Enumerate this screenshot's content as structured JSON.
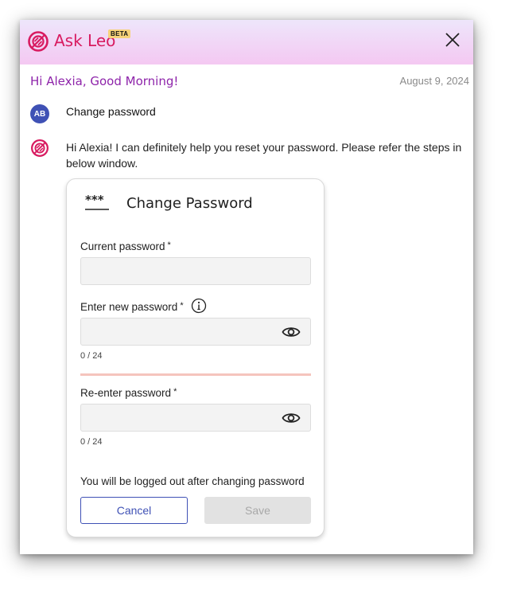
{
  "header": {
    "app_title": "Ask Leo",
    "badge": "BETA",
    "brand_color": "#d81b60",
    "close_icon": "close-icon"
  },
  "chat": {
    "greeting": "Hi Alexia, Good Morning!",
    "date": "August 9, 2024",
    "user_message": {
      "avatar_initials": "AB",
      "text": "Change password"
    },
    "bot_message": {
      "text": "Hi Alexia! I can definitely help you reset your password. Please refer the steps in below window."
    }
  },
  "change_password": {
    "icon": "password-asterisks-icon",
    "title": "Change Password",
    "current_password": {
      "label": "Current password",
      "required": "*",
      "value": ""
    },
    "new_password": {
      "label": "Enter new password",
      "required": "*",
      "value": "",
      "counter": "0 / 24"
    },
    "reenter_password": {
      "label": "Re-enter password",
      "required": "*",
      "value": "",
      "counter": "0 / 24"
    },
    "note": "You will be logged out after changing password",
    "cancel_label": "Cancel",
    "save_label": "Save"
  }
}
